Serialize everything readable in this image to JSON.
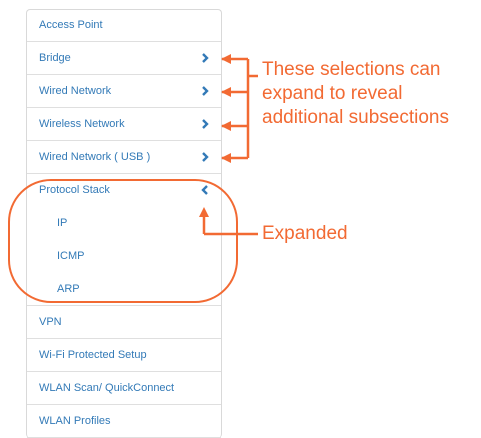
{
  "nav": {
    "items": [
      {
        "label": "Access Point",
        "chevron": null
      },
      {
        "label": "Bridge",
        "chevron": "chevron-right-icon"
      },
      {
        "label": "Wired Network",
        "chevron": "chevron-right-icon"
      },
      {
        "label": "Wireless Network",
        "chevron": "chevron-right-icon"
      },
      {
        "label": "Wired Network ( USB )",
        "chevron": "chevron-right-icon"
      },
      {
        "label": "Protocol Stack",
        "chevron": "chevron-left-icon"
      },
      {
        "label": "IP",
        "sub": true
      },
      {
        "label": "ICMP",
        "sub": true
      },
      {
        "label": "ARP",
        "sub": true
      },
      {
        "label": "VPN",
        "chevron": null
      },
      {
        "label": "Wi-Fi Protected Setup",
        "chevron": null
      },
      {
        "label": "WLAN Scan/ QuickConnect",
        "chevron": null
      },
      {
        "label": "WLAN Profiles",
        "chevron": null
      }
    ]
  },
  "annotations": {
    "expand_note": "These selections can expand to reveal additional subsections",
    "expanded_note": "Expanded"
  },
  "colors": {
    "link": "#337ab7",
    "annotation": "#f26a33",
    "border": "#d9d9d9"
  }
}
